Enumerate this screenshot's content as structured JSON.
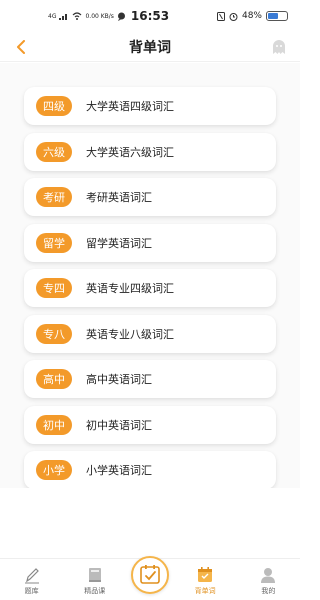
{
  "status_bar": {
    "network": "4G",
    "speed": "0.00 KB/s",
    "time": "16:53",
    "battery": "48%",
    "battery_level": 0.48
  },
  "header": {
    "title": "背单词"
  },
  "vocab_list": [
    {
      "badge": "四级",
      "label": "大学英语四级词汇"
    },
    {
      "badge": "六级",
      "label": "大学英语六级词汇"
    },
    {
      "badge": "考研",
      "label": "考研英语词汇"
    },
    {
      "badge": "留学",
      "label": "留学英语词汇"
    },
    {
      "badge": "专四",
      "label": "英语专业四级词汇"
    },
    {
      "badge": "专八",
      "label": "英语专业八级词汇"
    },
    {
      "badge": "高中",
      "label": "高中英语词汇"
    },
    {
      "badge": "初中",
      "label": "初中英语词汇"
    },
    {
      "badge": "小学",
      "label": "小学英语词汇"
    }
  ],
  "bottom_nav": {
    "items": [
      {
        "label": "题库",
        "icon": "pencil-icon"
      },
      {
        "label": "精品课",
        "icon": "book-icon"
      },
      {
        "label": "",
        "icon": "checklist-icon"
      },
      {
        "label": "背单词",
        "icon": "calendar-icon"
      },
      {
        "label": "我的",
        "icon": "person-icon"
      }
    ],
    "active": "背单词"
  },
  "colors": {
    "accent": "#f39a2a",
    "accent_light": "#f5b54a",
    "background": "#fafafa"
  }
}
